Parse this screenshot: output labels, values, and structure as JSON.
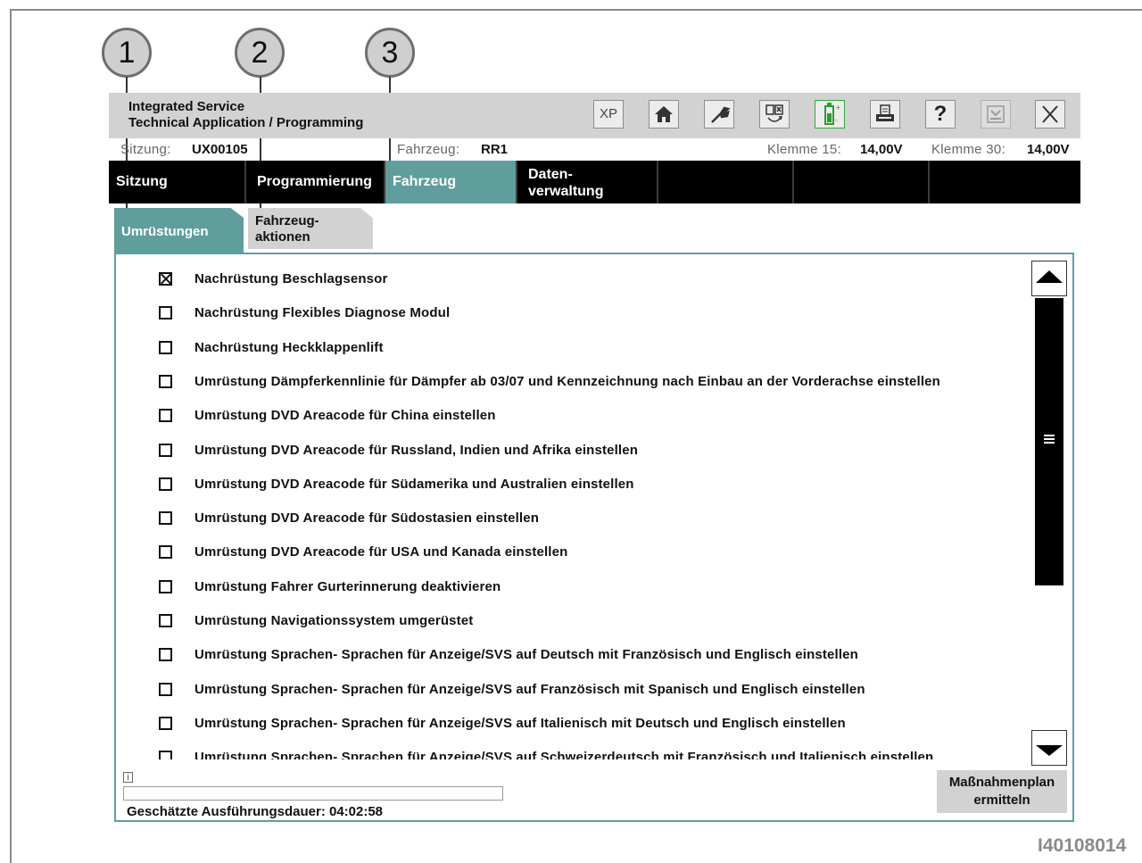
{
  "callouts": [
    "1",
    "2",
    "3"
  ],
  "app": {
    "title_line1": "Integrated Service",
    "title_line2": "Technical Application / Programming"
  },
  "toolbar": {
    "xp_label": "XP",
    "help_label": "?",
    "icons": [
      "xp-icon",
      "home-icon",
      "wrench-icon",
      "data-transfer-icon",
      "battery-icon",
      "printer-icon",
      "help-icon",
      "download-icon",
      "close-icon"
    ]
  },
  "session": {
    "session_label": "Sitzung:",
    "session_value": "UX00105",
    "vehicle_label": "Fahrzeug:",
    "vehicle_value": "RR1",
    "terminal15_label": "Klemme 15:",
    "terminal15_value": "14,00V",
    "terminal30_label": "Klemme 30:",
    "terminal30_value": "14,00V"
  },
  "nav": {
    "tabs": [
      {
        "label": "Sitzung",
        "active": false
      },
      {
        "label": "Programmierung",
        "active": false
      },
      {
        "label": "Fahrzeug",
        "active": true
      },
      {
        "label_line1": "Daten-",
        "label_line2": "verwaltung",
        "active": false
      }
    ]
  },
  "subtabs": {
    "active": "Umrüstungen",
    "inactive_line1": "Fahrzeug-",
    "inactive_line2": "aktionen"
  },
  "items": [
    {
      "label": "Nachrüstung Beschlagsensor",
      "checked": true
    },
    {
      "label": "Nachrüstung Flexibles Diagnose Modul",
      "checked": false
    },
    {
      "label": "Nachrüstung Heckklappenlift",
      "checked": false
    },
    {
      "label": "Umrüstung Dämpferkennlinie für Dämpfer ab 03/07 und Kennzeichnung nach Einbau an der Vorderachse einstellen",
      "checked": false
    },
    {
      "label": "Umrüstung DVD Areacode für China einstellen",
      "checked": false
    },
    {
      "label": "Umrüstung DVD Areacode für Russland, Indien und Afrika einstellen",
      "checked": false
    },
    {
      "label": "Umrüstung DVD Areacode für Südamerika und Australien einstellen",
      "checked": false
    },
    {
      "label": "Umrüstung DVD Areacode für Südostasien einstellen",
      "checked": false
    },
    {
      "label": "Umrüstung DVD Areacode für USA und Kanada einstellen",
      "checked": false
    },
    {
      "label": "Umrüstung Fahrer Gurterinnerung deaktivieren",
      "checked": false
    },
    {
      "label": "Umrüstung Navigationssystem umgerüstet",
      "checked": false
    },
    {
      "label": "Umrüstung Sprachen- Sprachen für Anzeige/SVS auf Deutsch mit Französisch und Englisch einstellen",
      "checked": false
    },
    {
      "label": "Umrüstung Sprachen- Sprachen für Anzeige/SVS auf Französisch mit Spanisch und Englisch einstellen",
      "checked": false
    },
    {
      "label": "Umrüstung Sprachen- Sprachen für Anzeige/SVS auf Italienisch mit Deutsch und Englisch einstellen",
      "checked": false
    },
    {
      "label": "Umrüstung Sprachen- Sprachen für Anzeige/SVS auf Schweizerdeutsch mit Französisch und Italienisch einstellen",
      "checked": false
    }
  ],
  "footer": {
    "info_icon": "i",
    "duration": "Geschätzte Ausführungsdauer: 04:02:58",
    "plan_button_line1": "Maßnahmenplan",
    "plan_button_line2": "ermitteln"
  },
  "figure_id": "I40108014",
  "colors": {
    "accent": "#5f9e9c",
    "header_gray": "#d2d2d2",
    "nav_black": "#000000"
  }
}
